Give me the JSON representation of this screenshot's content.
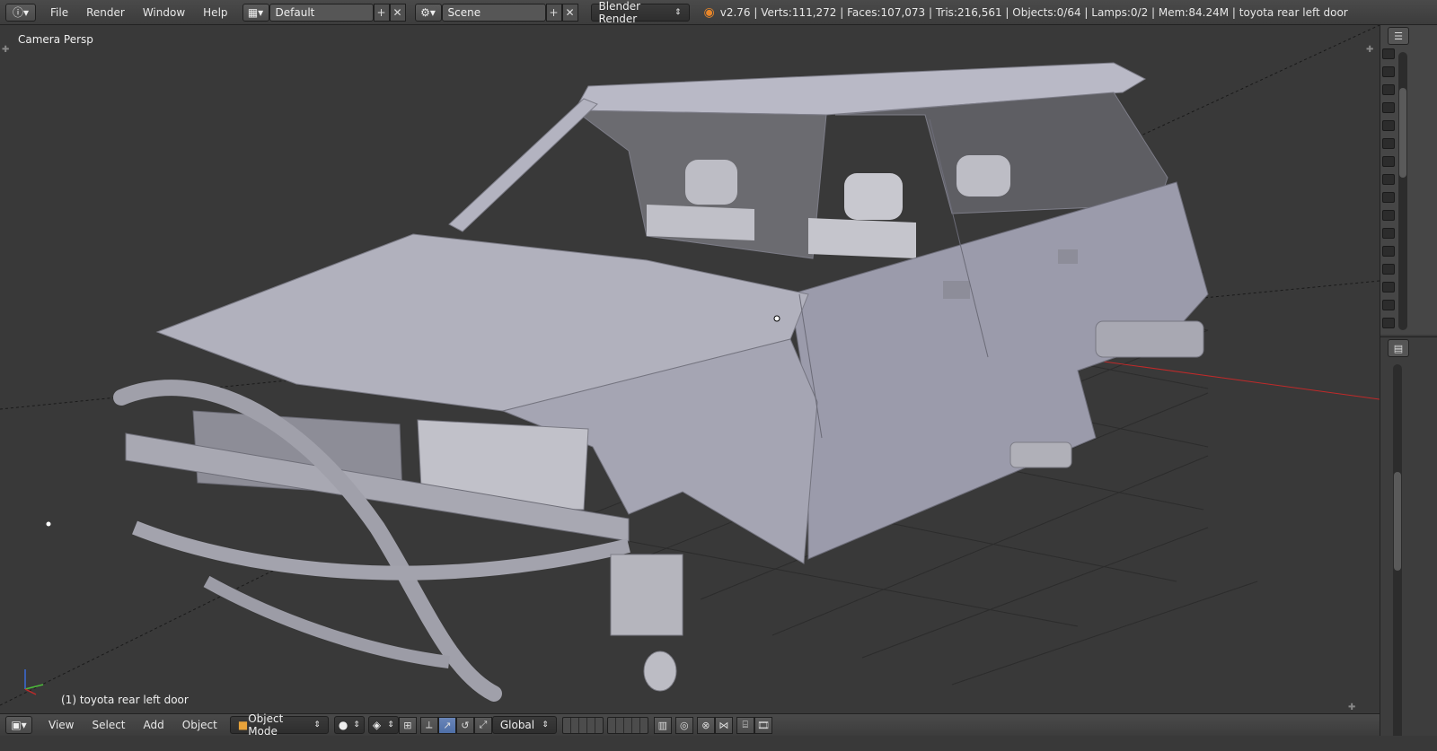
{
  "topbar": {
    "menus": [
      "File",
      "Render",
      "Window",
      "Help"
    ],
    "layout_field": "Default",
    "scene_field": "Scene",
    "render_engine": "Blender Render",
    "status": "v2.76 | Verts:111,272 | Faces:107,073 | Tris:216,561 | Objects:0/64 | Lamps:0/2 | Mem:84.24M | toyota rear left door"
  },
  "viewport": {
    "view_label": "Camera Persp",
    "selected_label": "(1) toyota rear left door"
  },
  "bottombar": {
    "menus": [
      "View",
      "Select",
      "Add",
      "Object"
    ],
    "mode": "Object Mode",
    "orientation": "Global"
  },
  "colors": {
    "background": "#393939",
    "header": "#444444",
    "x_axis": "#c02a2a",
    "car_body": "#a8a8b4"
  },
  "icons": [
    "info-icon",
    "layout-icon",
    "scene-icon",
    "render-engine-icon",
    "viewport-icon",
    "object-mode-icon",
    "shading-icon",
    "pivot-icon",
    "manipulator-icon",
    "layers-icon",
    "proportional-edit-icon",
    "snap-icon",
    "render-icon",
    "film-icon",
    "outliner-icon",
    "properties-icon"
  ]
}
